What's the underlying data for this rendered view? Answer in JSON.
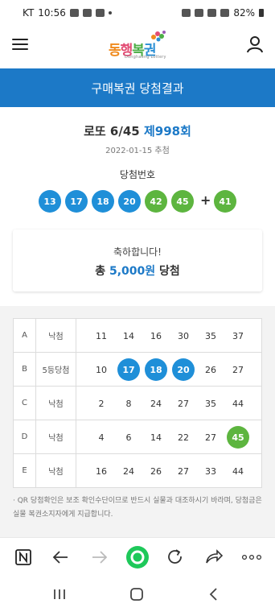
{
  "status_bar": {
    "carrier": "KT",
    "time": "10:56",
    "battery": "82%"
  },
  "header": {
    "logo_parts": [
      "동",
      "행",
      "복",
      "권"
    ],
    "logo_sub": "Donghaeng Lottery"
  },
  "title_bar": {
    "title": "구매복권 당첨결과"
  },
  "draw": {
    "game_name": "로또 6/45 ",
    "round": "제998회",
    "date": "2022-01-15 추첨",
    "win_label": "당첨번호",
    "numbers": [
      "13",
      "17",
      "18",
      "20",
      "42",
      "45"
    ],
    "plus": "+",
    "bonus": "41",
    "colors": {
      "blue": "#1f8fd8",
      "green": "#5db53f"
    }
  },
  "result": {
    "congrats": "축하합니다!",
    "prefix": "총 ",
    "amount": "5,000원",
    "suffix": " 당첨"
  },
  "tickets": [
    {
      "game": "A",
      "rank": "낙첨",
      "numbers": [
        "11",
        "14",
        "16",
        "30",
        "35",
        "37"
      ],
      "hits": []
    },
    {
      "game": "B",
      "rank": "5등당첨",
      "numbers": [
        "10",
        "17",
        "18",
        "20",
        "26",
        "27"
      ],
      "hits": [
        1,
        2,
        3
      ]
    },
    {
      "game": "C",
      "rank": "낙첨",
      "numbers": [
        "2",
        "8",
        "24",
        "27",
        "35",
        "44"
      ],
      "hits": []
    },
    {
      "game": "D",
      "rank": "낙첨",
      "numbers": [
        "4",
        "6",
        "14",
        "22",
        "27",
        "45"
      ],
      "hits": [
        5
      ]
    },
    {
      "game": "E",
      "rank": "낙첨",
      "numbers": [
        "16",
        "24",
        "26",
        "27",
        "33",
        "44"
      ],
      "hits": []
    }
  ],
  "notice": "· QR 당첨확인은 보조 확인수단이므로 반드시 실물과 대조하시기 바라며, 당첨금은 실물 복권소지자에게 지급합니다.",
  "browser_bar": {
    "icons": [
      "n-tab-icon",
      "back-icon",
      "forward-icon",
      "home-green-icon",
      "refresh-icon",
      "share-icon",
      "more-icon"
    ]
  },
  "nav_bar": {
    "icons": [
      "recents-icon",
      "home-icon",
      "back-icon"
    ]
  }
}
